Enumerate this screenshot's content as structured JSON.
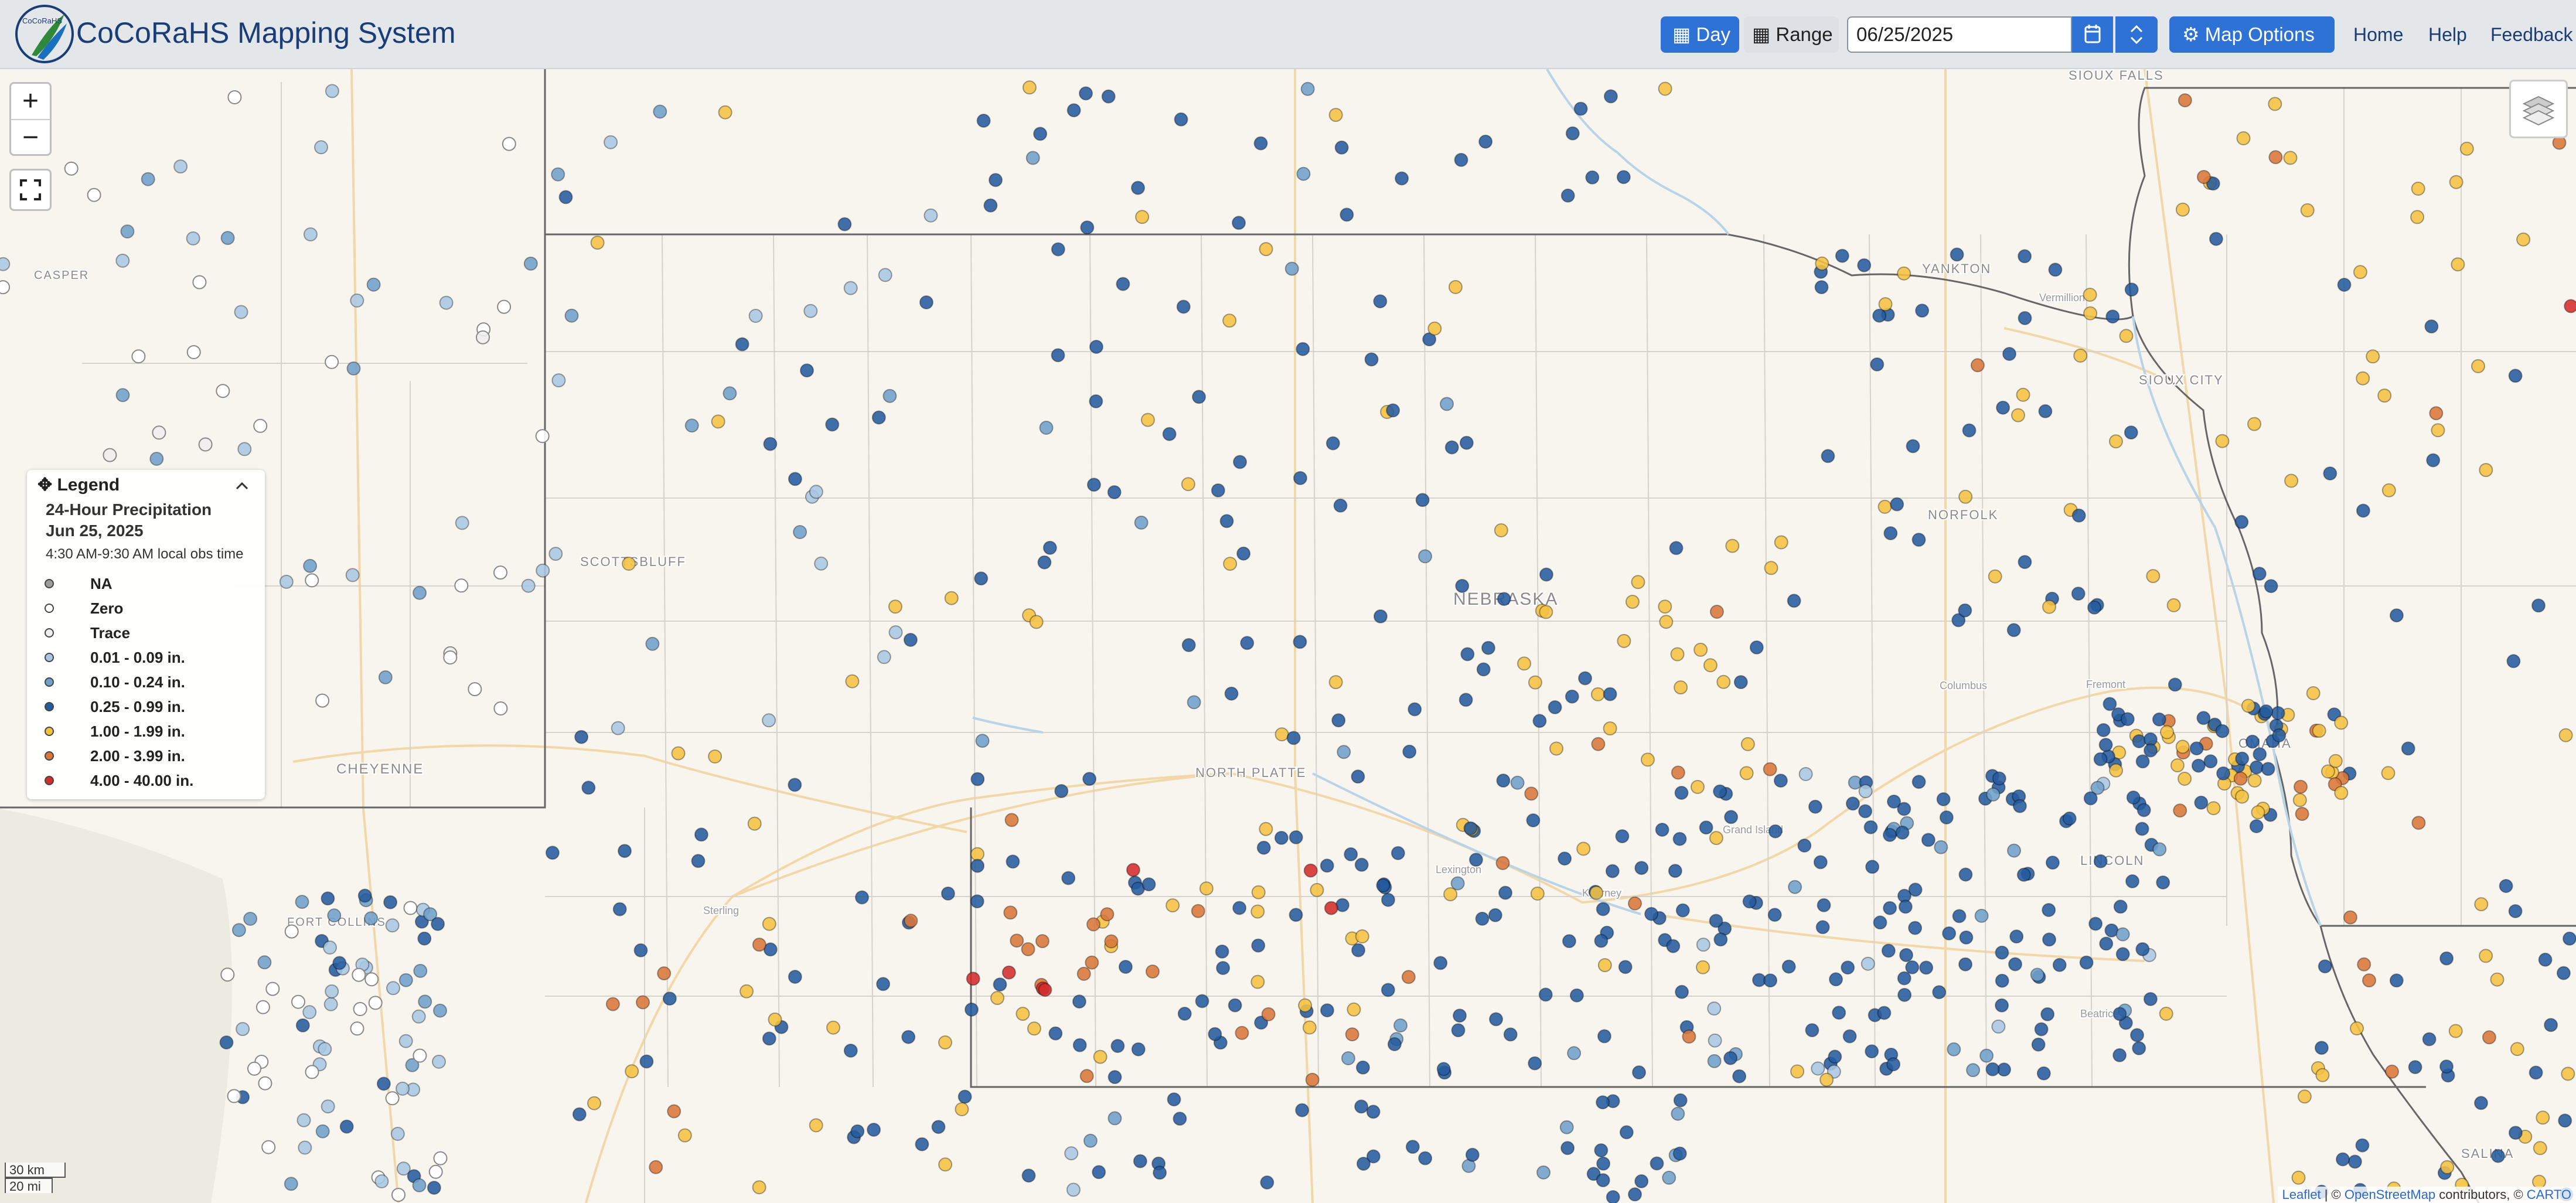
{
  "header": {
    "logo_text": "CoCoRaHS",
    "title": "CoCoRaHS Mapping System",
    "day_label": "Day",
    "range_label": "Range",
    "date_value": "06/25/2025",
    "map_options_label": "Map Options",
    "nav": {
      "home": "Home",
      "help": "Help",
      "feedback": "Feedback"
    }
  },
  "controls": {
    "zoom_in": "+",
    "zoom_out": "−"
  },
  "legend": {
    "heading": "Legend",
    "title": "24-Hour Precipitation",
    "date": "Jun 25, 2025",
    "obs_time": "4:30 AM-9:30 AM local obs time",
    "classes": [
      {
        "key": "na",
        "label": "NA",
        "color": "#9c9c9c"
      },
      {
        "key": "zero",
        "label": "Zero",
        "color": "#ffffff"
      },
      {
        "key": "trace",
        "label": "Trace",
        "color": "#eeeeee"
      },
      {
        "key": "c1",
        "label": "0.01 - 0.09 in.",
        "color": "#a9c7e2"
      },
      {
        "key": "c2",
        "label": "0.10 - 0.24 in.",
        "color": "#6f9fcb"
      },
      {
        "key": "c3",
        "label": "0.25 - 0.99 in.",
        "color": "#245b9e"
      },
      {
        "key": "c4",
        "label": "1.00 - 1.99 in.",
        "color": "#f4c242"
      },
      {
        "key": "c5",
        "label": "2.00 - 3.99 in.",
        "color": "#d8763a"
      },
      {
        "key": "c6",
        "label": "4.00 - 40.00 in.",
        "color": "#d22c2c"
      }
    ]
  },
  "map_labels": [
    {
      "key": "nebraska",
      "text": "NEBRASKA"
    },
    {
      "key": "north_platte",
      "text": "NORTH PLATTE"
    },
    {
      "key": "scottsbluff",
      "text": "SCOTTSBLUFF"
    },
    {
      "key": "cheyenne",
      "text": "CHEYENNE"
    },
    {
      "key": "norfolk",
      "text": "NORFOLK"
    },
    {
      "key": "sioux_city",
      "text": "SIOUX CITY"
    },
    {
      "key": "sioux_falls",
      "text": "SIOUX FALLS"
    },
    {
      "key": "yankton",
      "text": "YANKTON"
    },
    {
      "key": "vermillion",
      "text": "Vermillion"
    },
    {
      "key": "columbus",
      "text": "Columbus"
    },
    {
      "key": "fremont",
      "text": "Fremont"
    },
    {
      "key": "grand_island",
      "text": "Grand Island"
    },
    {
      "key": "kearney",
      "text": "Kearney"
    },
    {
      "key": "lexington",
      "text": "Lexington"
    },
    {
      "key": "lincoln",
      "text": "LINCOLN"
    },
    {
      "key": "beatrice",
      "text": "Beatrice"
    },
    {
      "key": "sterling",
      "text": "Sterling"
    },
    {
      "key": "fort_collins",
      "text": "FORT COLLINS"
    },
    {
      "key": "casper",
      "text": "CASPER"
    },
    {
      "key": "omaha",
      "text": "OMAHA"
    },
    {
      "key": "salina",
      "text": "SALINA"
    }
  ],
  "scale": {
    "km": "30 km",
    "mi": "20 mi"
  },
  "attribution": {
    "leaflet": "Leaflet",
    "sep": " | © ",
    "osm": "OpenStreetMap",
    "mid": " contributors, © ",
    "carto": "CARTO"
  }
}
